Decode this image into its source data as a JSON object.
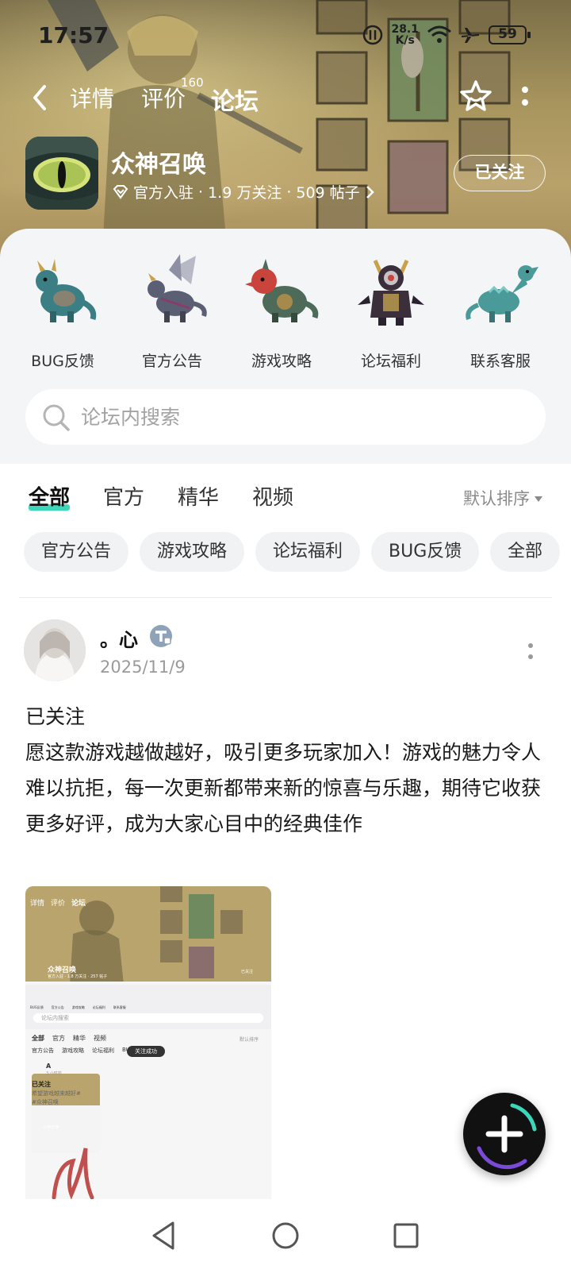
{
  "status_bar": {
    "time": "17:57",
    "net_speed_value": "28.1",
    "net_speed_unit": "K/s",
    "battery": "59"
  },
  "nav": {
    "tabs": [
      {
        "label": "详情"
      },
      {
        "label": "评价"
      },
      {
        "label": "论坛"
      }
    ],
    "review_count": "160",
    "active_tab": "论坛"
  },
  "app": {
    "name": "众神召唤",
    "meta_official": "官方入驻",
    "meta_followers": "1.9 万关注",
    "meta_posts": "509 帖子",
    "follow_label": "已关注"
  },
  "categories": [
    {
      "label": "BUG反馈",
      "color": "#3b7f84"
    },
    {
      "label": "官方公告",
      "color": "#5a5f73"
    },
    {
      "label": "游戏攻略",
      "color": "#4d6b58"
    },
    {
      "label": "论坛福利",
      "color": "#3a2f3b"
    },
    {
      "label": "联系客服",
      "color": "#4a9a9a"
    }
  ],
  "search": {
    "placeholder": "论坛内搜索"
  },
  "feed_tabs": [
    {
      "label": "全部"
    },
    {
      "label": "官方"
    },
    {
      "label": "精华"
    },
    {
      "label": "视频"
    }
  ],
  "sort_label": "默认排序",
  "chips": [
    {
      "label": "官方公告"
    },
    {
      "label": "游戏攻略"
    },
    {
      "label": "论坛福利"
    },
    {
      "label": "BUG反馈"
    },
    {
      "label": "全部"
    }
  ],
  "post": {
    "author": "。心",
    "date": "2025/11/9",
    "line1": "已关注",
    "content": "愿这款游戏越做越好，吸引更多玩家加入！游戏的魅力令人难以抗拒，每一次更新都带来新的惊喜与乐趣，期待它收获更多好评，成为大家心目中的经典佳作",
    "image": {
      "nav_tabs": [
        "详情",
        "评价",
        "论坛"
      ],
      "app_name": "众神召唤",
      "app_meta": "官方入驻 · 1.8 万关注 · 257 帖子",
      "follow_label": "已关注",
      "cats": [
        "BUG反馈",
        "官方公告",
        "游戏攻略",
        "论坛福利",
        "联系客服"
      ],
      "search": "论坛内搜索",
      "tabs": [
        "全部",
        "官方",
        "精华",
        "视频"
      ],
      "sort": "默认排序",
      "chips": [
        "官方公告",
        "游戏攻略",
        "论坛福利",
        "BUG"
      ],
      "toast": "关注成功",
      "post_author": "A",
      "post_time": "3 小时前",
      "post_line1": "已关注",
      "post_line2": "希望游戏越来越好#",
      "post_line3": "#众神召唤",
      "nested_app_name": "众神召唤"
    }
  },
  "colors": {
    "accent": "#3ed6b8",
    "hero": "#a8955e"
  }
}
